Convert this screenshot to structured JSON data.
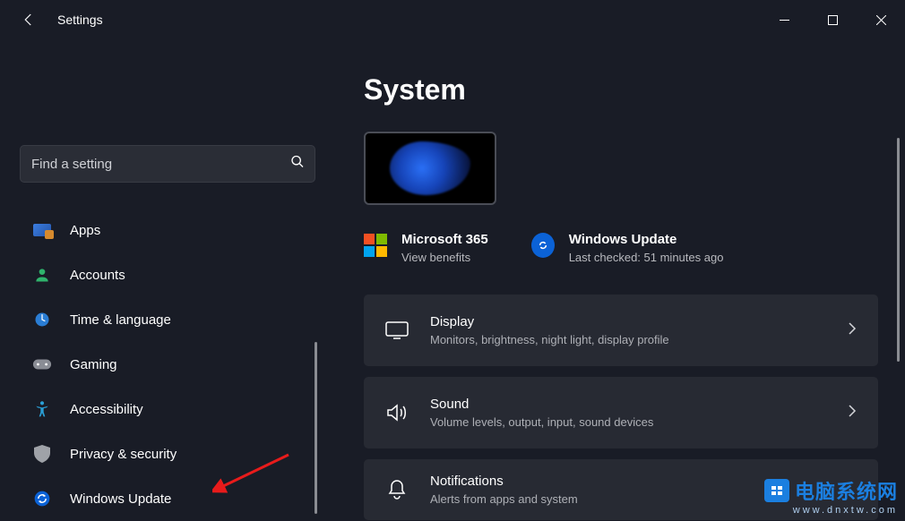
{
  "app_title": "Settings",
  "search_placeholder": "Find a setting",
  "sidebar": {
    "items": [
      {
        "label": "Apps"
      },
      {
        "label": "Accounts"
      },
      {
        "label": "Time & language"
      },
      {
        "label": "Gaming"
      },
      {
        "label": "Accessibility"
      },
      {
        "label": "Privacy & security"
      },
      {
        "label": "Windows Update"
      }
    ]
  },
  "page_title": "System",
  "info": {
    "ms365": {
      "title": "Microsoft 365",
      "subtitle": "View benefits"
    },
    "wu": {
      "title": "Windows Update",
      "subtitle": "Last checked: 51 minutes ago"
    }
  },
  "cards": [
    {
      "title": "Display",
      "subtitle": "Monitors, brightness, night light, display profile"
    },
    {
      "title": "Sound",
      "subtitle": "Volume levels, output, input, sound devices"
    },
    {
      "title": "Notifications",
      "subtitle": "Alerts from apps and system"
    }
  ],
  "watermark": {
    "text": "电脑系统网",
    "url": "www.dnxtw.com"
  }
}
